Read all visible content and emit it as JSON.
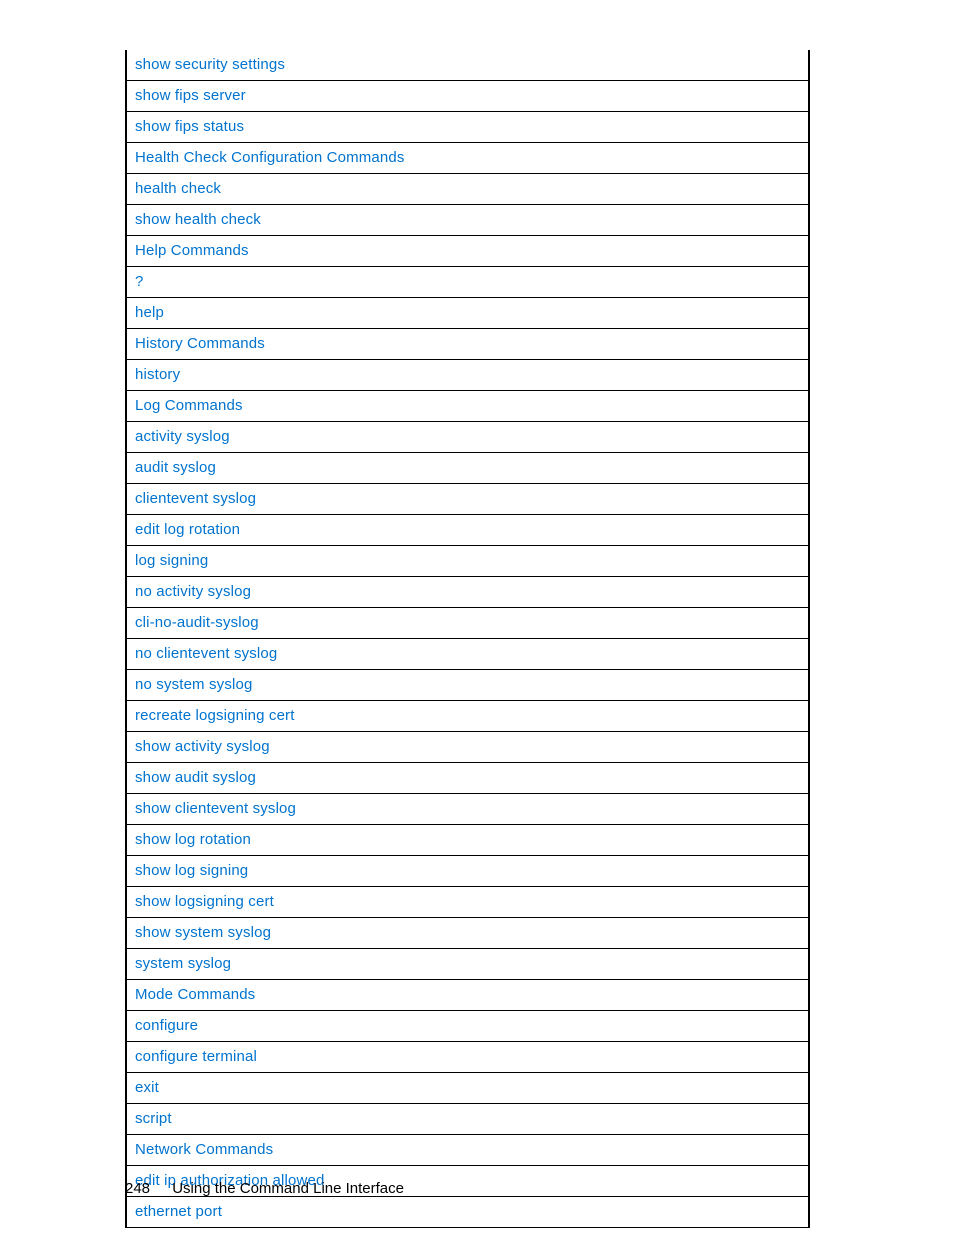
{
  "footer": {
    "page_number": "248",
    "text": "Using the Command Line Interface"
  },
  "rows": [
    {
      "label": "show security settings",
      "slug": "show-security-settings"
    },
    {
      "label": "show fips server",
      "slug": "show-fips-server"
    },
    {
      "label": "show fips status",
      "slug": "show-fips-status"
    },
    {
      "label": "Health Check Configuration Commands",
      "slug": "health-check-configuration-commands"
    },
    {
      "label": "health check",
      "slug": "health-check"
    },
    {
      "label": "show health check",
      "slug": "show-health-check"
    },
    {
      "label": "Help Commands",
      "slug": "help-commands"
    },
    {
      "label": "?",
      "slug": "question-mark"
    },
    {
      "label": "help",
      "slug": "help"
    },
    {
      "label": "History Commands",
      "slug": "history-commands"
    },
    {
      "label": "history",
      "slug": "history"
    },
    {
      "label": "Log Commands",
      "slug": "log-commands"
    },
    {
      "label": "activity syslog",
      "slug": "activity-syslog"
    },
    {
      "label": "audit syslog",
      "slug": "audit-syslog"
    },
    {
      "label": "clientevent syslog",
      "slug": "clientevent-syslog"
    },
    {
      "label": "edit log rotation",
      "slug": "edit-log-rotation"
    },
    {
      "label": "log signing",
      "slug": "log-signing"
    },
    {
      "label": "no activity syslog",
      "slug": "no-activity-syslog"
    },
    {
      "label": "cli-no-audit-syslog",
      "slug": "cli-no-audit-syslog"
    },
    {
      "label": "no clientevent syslog",
      "slug": "no-clientevent-syslog"
    },
    {
      "label": "no system syslog",
      "slug": "no-system-syslog"
    },
    {
      "label": "recreate logsigning cert",
      "slug": "recreate-logsigning-cert"
    },
    {
      "label": "show activity syslog",
      "slug": "show-activity-syslog"
    },
    {
      "label": "show audit syslog",
      "slug": "show-audit-syslog"
    },
    {
      "label": "show clientevent syslog",
      "slug": "show-clientevent-syslog"
    },
    {
      "label": "show log rotation",
      "slug": "show-log-rotation"
    },
    {
      "label": "show log signing",
      "slug": "show-log-signing"
    },
    {
      "label": "show logsigning cert",
      "slug": "show-logsigning-cert"
    },
    {
      "label": "show system syslog",
      "slug": "show-system-syslog"
    },
    {
      "label": "system syslog",
      "slug": "system-syslog"
    },
    {
      "label": "Mode Commands",
      "slug": "mode-commands"
    },
    {
      "label": "configure",
      "slug": "configure"
    },
    {
      "label": "configure terminal",
      "slug": "configure-terminal"
    },
    {
      "label": "exit",
      "slug": "exit"
    },
    {
      "label": "script",
      "slug": "script"
    },
    {
      "label": "Network Commands",
      "slug": "network-commands"
    },
    {
      "label": "edit ip authorization allowed",
      "slug": "edit-ip-authorization-allowed"
    },
    {
      "label": "ethernet port",
      "slug": "ethernet-port"
    }
  ]
}
